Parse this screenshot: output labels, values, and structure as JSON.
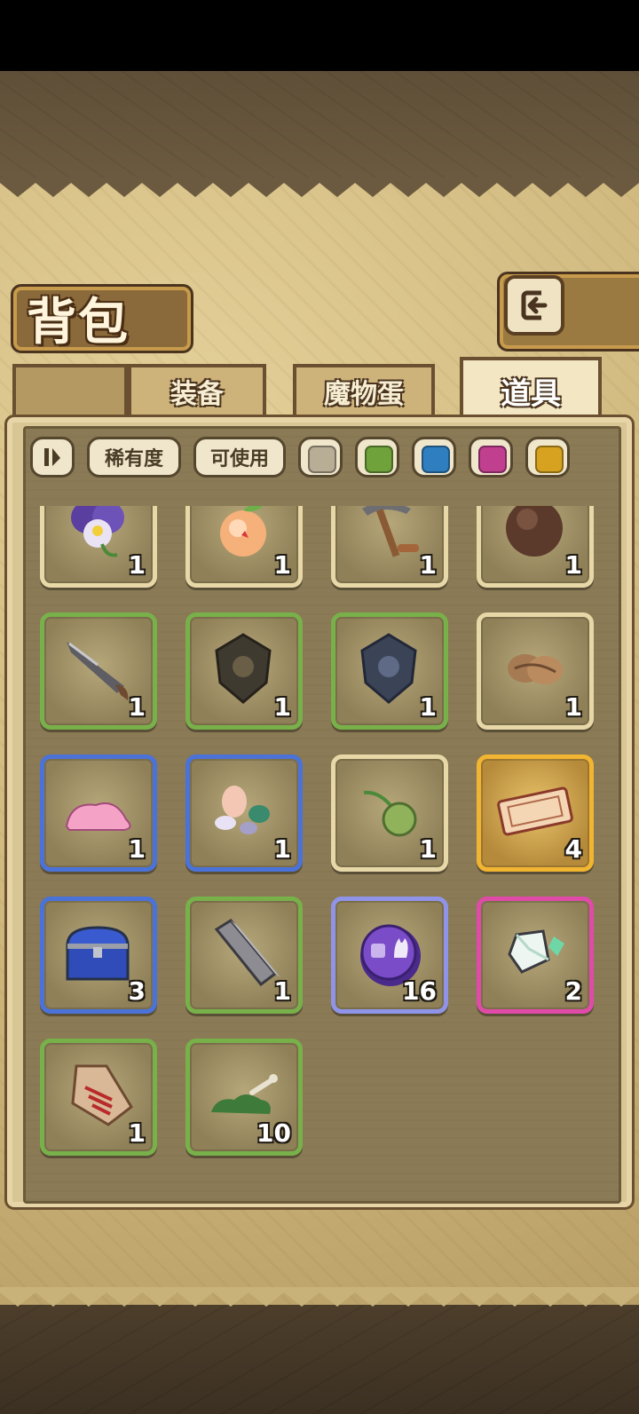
{
  "header": {
    "title": "背包"
  },
  "tabs": [
    {
      "label": "装备"
    },
    {
      "label": "魔物蛋"
    },
    {
      "label": "道具",
      "active": true
    }
  ],
  "filters": {
    "sort_icon": "sort-icon",
    "rarity_label": "稀有度",
    "usable_label": "可使用",
    "rarity_colors": [
      "#b8ad95",
      "#6fa23a",
      "#2f7fc0",
      "#c0408f",
      "#d6a21f"
    ]
  },
  "items": [
    {
      "icon": "pansy-flower-icon",
      "rarity": "white",
      "count": "1"
    },
    {
      "icon": "peach-icon",
      "rarity": "white",
      "count": "1"
    },
    {
      "icon": "pickaxe-icon",
      "rarity": "white",
      "count": "1"
    },
    {
      "icon": "fur-ball-icon",
      "rarity": "white",
      "count": "1"
    },
    {
      "icon": "feather-knife-icon",
      "rarity": "green",
      "count": "1"
    },
    {
      "icon": "dark-emblem-icon",
      "rarity": "green",
      "count": "1"
    },
    {
      "icon": "blue-emblem-icon",
      "rarity": "green",
      "count": "1"
    },
    {
      "icon": "yarn-ball-icon",
      "rarity": "white",
      "count": "1"
    },
    {
      "icon": "pink-slime-icon",
      "rarity": "blue",
      "count": "1"
    },
    {
      "icon": "candy-pile-icon",
      "rarity": "blue",
      "count": "1"
    },
    {
      "icon": "green-seed-icon",
      "rarity": "white",
      "count": "1"
    },
    {
      "icon": "ticket-icon",
      "rarity": "gold",
      "count": "4"
    },
    {
      "icon": "treasure-chest-icon",
      "rarity": "blue",
      "count": "3"
    },
    {
      "icon": "metal-bar-icon",
      "rarity": "green",
      "count": "1"
    },
    {
      "icon": "purple-coin-icon",
      "rarity": "lav",
      "count": "16"
    },
    {
      "icon": "crystal-icon",
      "rarity": "pink",
      "count": "2"
    },
    {
      "icon": "fish-tag-icon",
      "rarity": "green",
      "count": "1"
    },
    {
      "icon": "moss-bone-icon",
      "rarity": "green",
      "count": "10"
    }
  ]
}
